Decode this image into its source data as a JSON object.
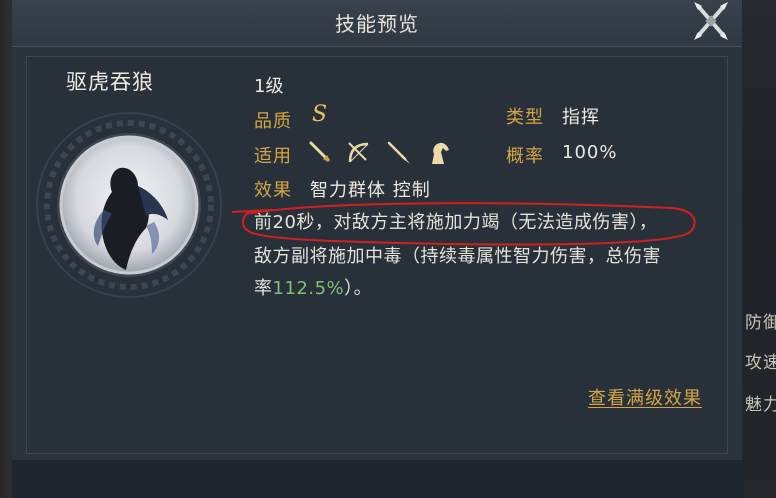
{
  "dialog": {
    "title": "技能预览",
    "close_icon": "crossed-swords-close-icon"
  },
  "skill": {
    "name": "驱虎吞狼",
    "level": "1级",
    "quality_label": "品质",
    "quality_value": "S",
    "type_label": "类型",
    "type_value": "指挥",
    "applicable_label": "适用",
    "applicable_units": [
      "sword-icon",
      "bow-icon",
      "spear-icon",
      "horse-icon"
    ],
    "chance_label": "概率",
    "chance_value": "100%",
    "effect_label": "效果",
    "effect_tags": "智力群体 控制",
    "description": {
      "line1": "前20秒，对敌方主将施加力竭（无法造成伤害），",
      "line2": "敌方副将施加中毒（持续毒属性智力伤害，总伤害",
      "line3_prefix": "率",
      "line3_value": "112.5%",
      "line3_suffix": "）。"
    },
    "view_full_effect": "查看满级效果"
  },
  "background_side_text": [
    "防御",
    "攻速",
    "魅力"
  ],
  "colors": {
    "accent_gold": "#d4a545",
    "highlight_green": "#7fbf7d",
    "annotation_red": "#d41f1f"
  }
}
